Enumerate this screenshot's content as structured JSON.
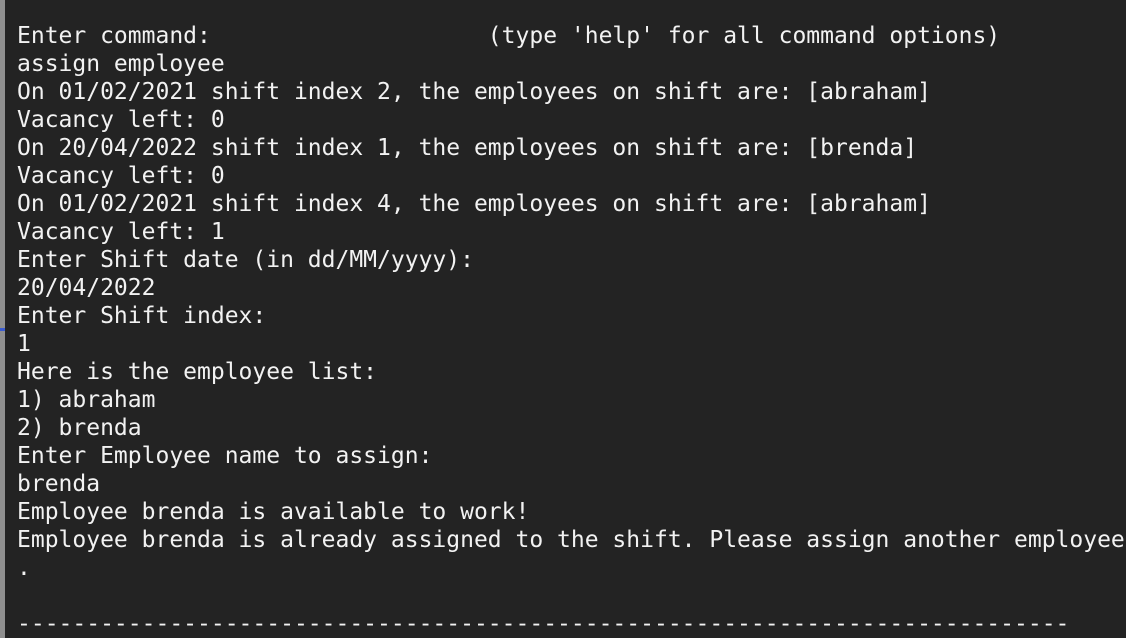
{
  "terminal": {
    "lines": [
      "Enter command:                    (type 'help' for all command options)",
      "assign employee",
      "On 01/02/2021 shift index 2, the employees on shift are: [abraham]",
      "Vacancy left: 0",
      "On 20/04/2022 shift index 1, the employees on shift are: [brenda]",
      "Vacancy left: 0",
      "On 01/02/2021 shift index 4, the employees on shift are: [abraham]",
      "Vacancy left: 1",
      "Enter Shift date (in dd/MM/yyyy):",
      "20/04/2022",
      "Enter Shift index:",
      "1",
      "Here is the employee list:",
      "1) abraham",
      "2) brenda",
      "Enter Employee name to assign:",
      "brenda",
      "Employee brenda is available to work!",
      "Employee brenda is already assigned to the shift. Please assign another employee",
      ".",
      "",
      "----------------------------------------------------------------------------"
    ]
  }
}
